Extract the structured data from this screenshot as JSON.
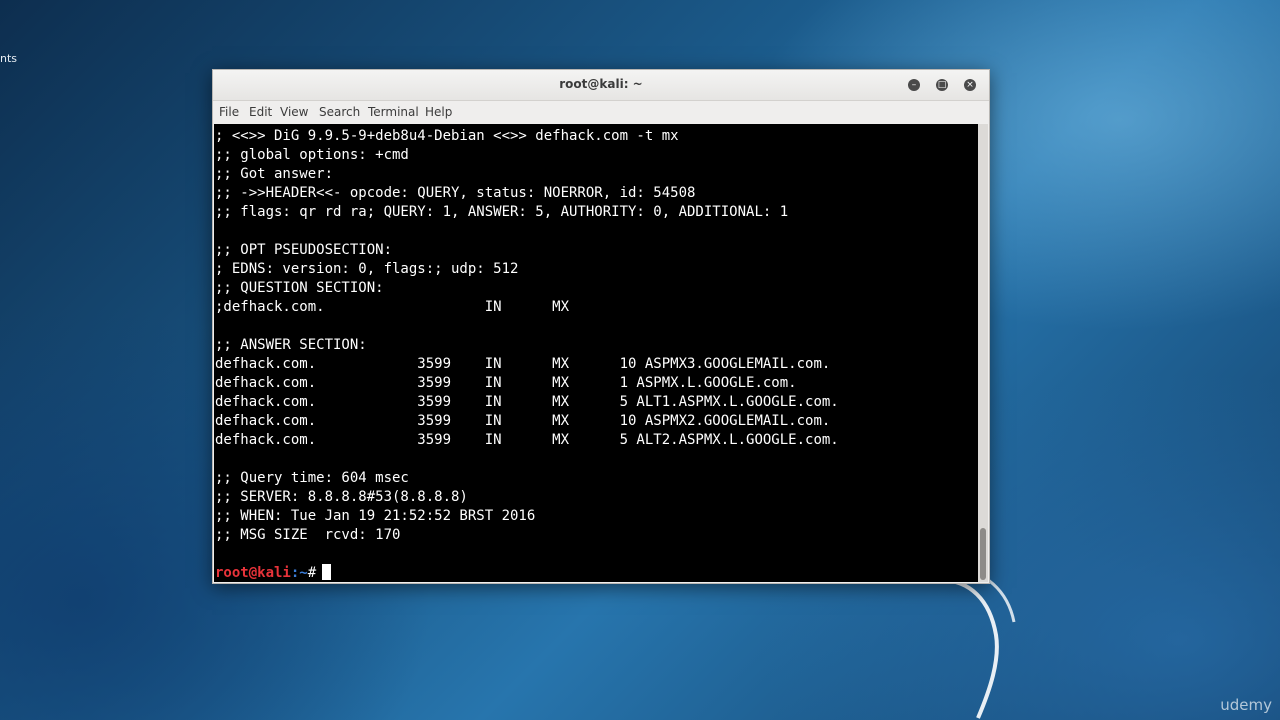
{
  "desktop": {
    "left_text": "nts",
    "watermark": "udemy"
  },
  "window": {
    "title": "root@kali: ~",
    "controls": {
      "minimize_icon": "–",
      "maximize_icon": "□",
      "close_icon": "×"
    },
    "menu": [
      "File",
      "Edit",
      "View",
      "Search",
      "Terminal",
      "Help"
    ]
  },
  "terminal": {
    "lines": [
      "; <<>> DiG 9.9.5-9+deb8u4-Debian <<>> defhack.com -t mx",
      ";; global options: +cmd",
      ";; Got answer:",
      ";; ->>HEADER<<- opcode: QUERY, status: NOERROR, id: 54508",
      ";; flags: qr rd ra; QUERY: 1, ANSWER: 5, AUTHORITY: 0, ADDITIONAL: 1",
      "",
      ";; OPT PSEUDOSECTION:",
      "; EDNS: version: 0, flags:; udp: 512",
      ";; QUESTION SECTION:",
      ";defhack.com.                   IN      MX",
      "",
      ";; ANSWER SECTION:",
      "defhack.com.            3599    IN      MX      10 ASPMX3.GOOGLEMAIL.com.",
      "defhack.com.            3599    IN      MX      1 ASPMX.L.GOOGLE.com.",
      "defhack.com.            3599    IN      MX      5 ALT1.ASPMX.L.GOOGLE.com.",
      "defhack.com.            3599    IN      MX      10 ASPMX2.GOOGLEMAIL.com.",
      "defhack.com.            3599    IN      MX      5 ALT2.ASPMX.L.GOOGLE.com.",
      "",
      ";; Query time: 604 msec",
      ";; SERVER: 8.8.8.8#53(8.8.8.8)",
      ";; WHEN: Tue Jan 19 21:52:52 BRST 2016",
      ";; MSG SIZE  rcvd: 170",
      ""
    ],
    "prompt": {
      "user": "root@kali",
      "path": ":~",
      "symbol": "#"
    }
  },
  "colors": {
    "prompt_user": "#e8333a",
    "prompt_path": "#3b7dd8",
    "terminal_bg": "#000000",
    "terminal_fg": "#ffffff"
  }
}
